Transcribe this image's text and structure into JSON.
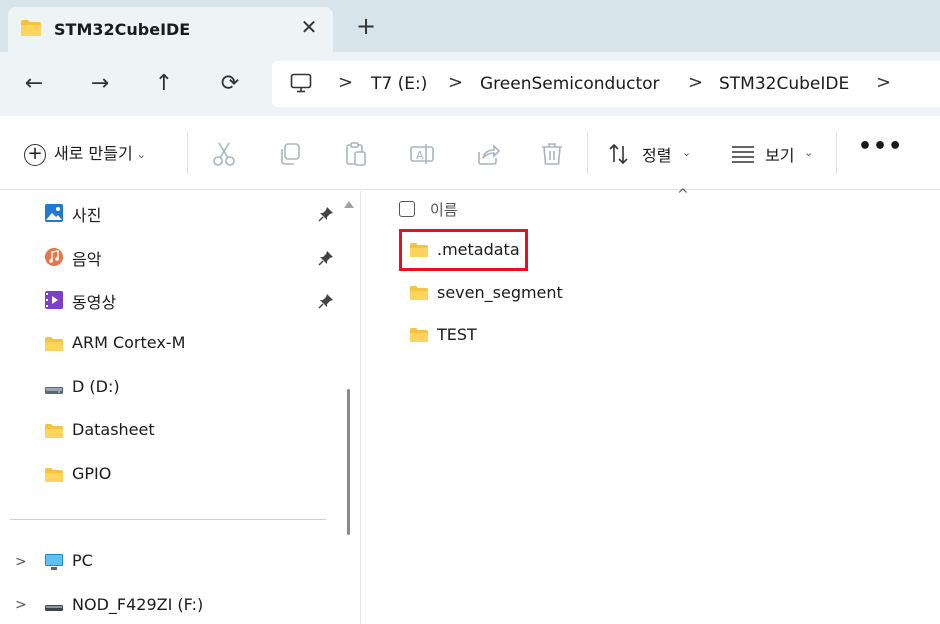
{
  "window": {
    "tab_title": "STM32CubeIDE",
    "close_glyph": "✕",
    "new_tab_glyph": "+"
  },
  "nav": {
    "back": "←",
    "forward": "→",
    "up": "↑",
    "refresh": "⟳"
  },
  "breadcrumb": {
    "separator": ">",
    "items": [
      "T7 (E:)",
      "GreenSemiconductor",
      "STM32CubeIDE"
    ]
  },
  "toolbar": {
    "new_label": "새로 만들기",
    "sort_label": "정렬",
    "view_label": "보기",
    "more_label": "•••",
    "dropdown_glyph": "⌄",
    "icons": [
      "cut-icon",
      "copy-icon",
      "paste-icon",
      "rename-icon",
      "share-icon",
      "delete-icon"
    ]
  },
  "sidebar": {
    "pinned": [
      {
        "label": "사진",
        "icon": "pictures-icon"
      },
      {
        "label": "음악",
        "icon": "music-icon"
      },
      {
        "label": "동영상",
        "icon": "videos-icon"
      }
    ],
    "items": [
      {
        "label": "ARM Cortex-M",
        "icon": "folder-icon"
      },
      {
        "label": "D (D:)",
        "icon": "drive-icon"
      },
      {
        "label": "Datasheet",
        "icon": "folder-icon"
      },
      {
        "label": "GPIO",
        "icon": "folder-icon"
      }
    ],
    "devices": [
      {
        "label": "PC",
        "icon": "pc-icon"
      },
      {
        "label": "NOD_F429ZI (F:)",
        "icon": "drive-icon"
      }
    ],
    "expander_glyph": ">"
  },
  "content": {
    "column_header": "이름",
    "sort_caret": "^",
    "files": [
      {
        "name": ".metadata",
        "icon": "folder-icon",
        "highlighted": true
      },
      {
        "name": "seven_segment",
        "icon": "folder-icon"
      },
      {
        "name": "TEST",
        "icon": "folder-icon"
      }
    ]
  },
  "colors": {
    "folder": "#f5c342",
    "highlight": "#e0141e",
    "titlebar": "#d8e4ec",
    "navbar": "#eef3f6"
  }
}
